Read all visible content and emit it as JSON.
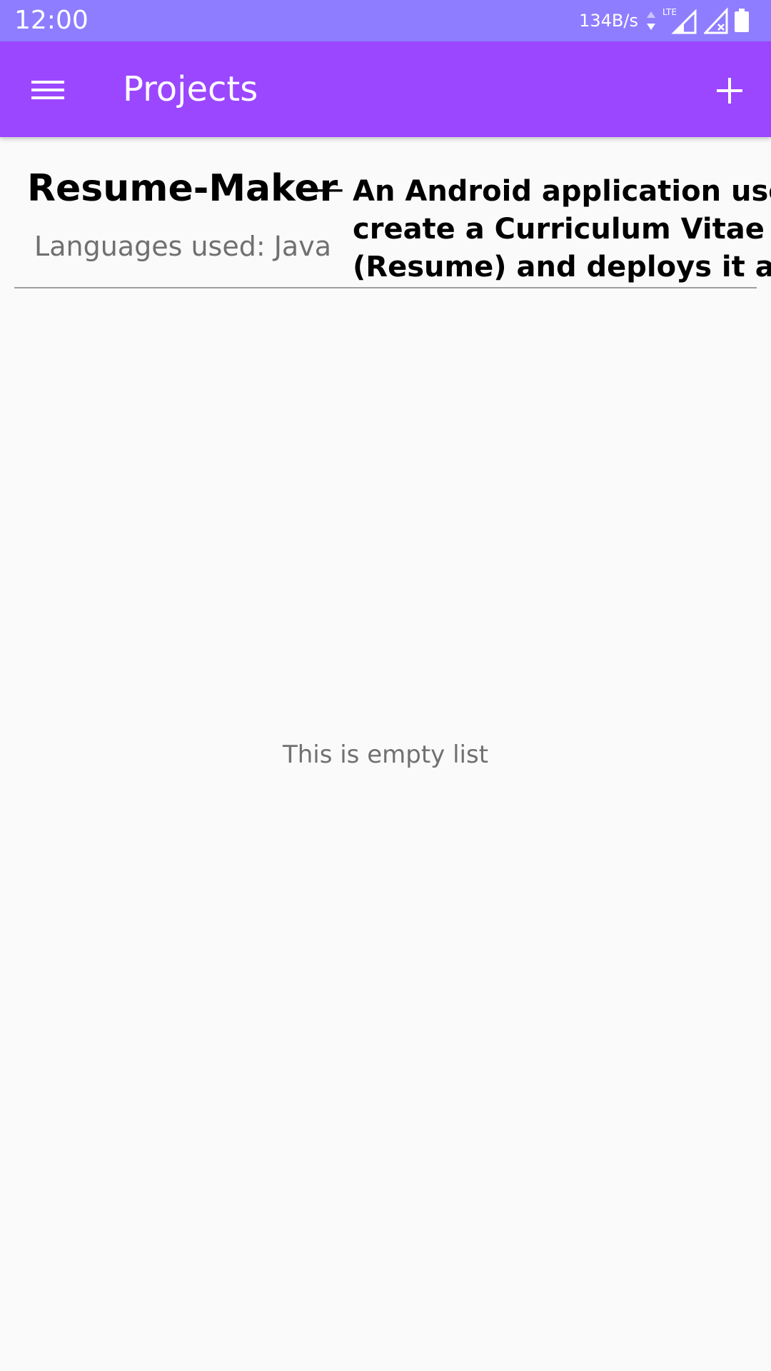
{
  "status_bar": {
    "time": "12:00",
    "network_speed": "134B/s",
    "icons": [
      "data-transfer-icon",
      "lte-signal-icon",
      "no-signal-icon",
      "battery-icon"
    ],
    "network_type": "LTE",
    "background_color": "#8f7dff"
  },
  "app_bar": {
    "title": "Projects",
    "menu_icon": "hamburger-menu-icon",
    "add_icon": "plus-icon",
    "background_color": "#9b47ff"
  },
  "projects": [
    {
      "name": "Resume-Maker",
      "separator": "—",
      "languages": "Languages used: Java",
      "description": "An Android application used to create a Curriculum Vitae - (Resume) and deploys it as a PDF format to"
    }
  ],
  "empty_message": "This is empty list"
}
